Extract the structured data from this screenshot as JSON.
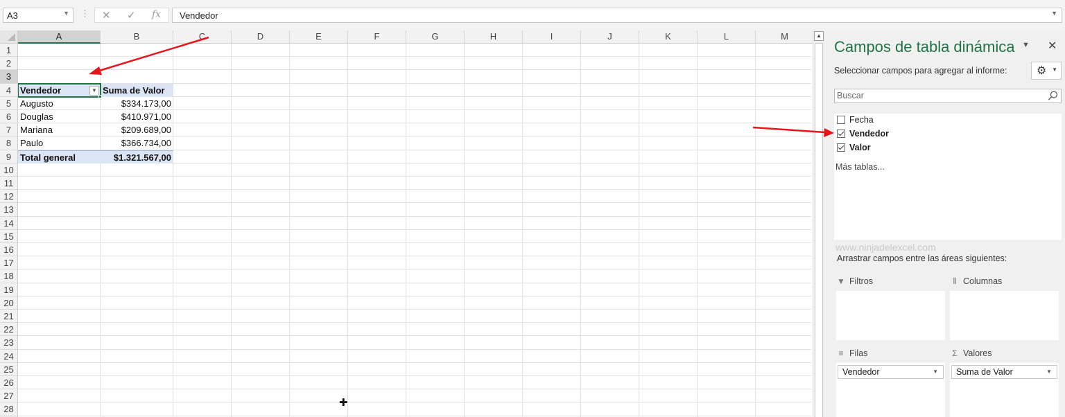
{
  "name_box": {
    "value": "A3"
  },
  "formula_bar": {
    "fx": "fx",
    "value": "Vendedor"
  },
  "columns": [
    "A",
    "B",
    "C",
    "D",
    "E",
    "F",
    "G",
    "H",
    "I",
    "J",
    "K",
    "L",
    "M"
  ],
  "rows": [
    "1",
    "2",
    "3",
    "4",
    "5",
    "6",
    "7",
    "8",
    "9",
    "10",
    "11",
    "12",
    "13",
    "14",
    "15",
    "16",
    "17",
    "18",
    "19",
    "20",
    "21",
    "22",
    "23",
    "24",
    "25",
    "26",
    "27",
    "28"
  ],
  "pivot_table": {
    "header_row": [
      "Vendedor",
      "Suma de Valor"
    ],
    "rows": [
      [
        "Augusto",
        "$334.173,00"
      ],
      [
        "Douglas",
        "$410.971,00"
      ],
      [
        "Mariana",
        "$209.689,00"
      ],
      [
        "Paulo",
        "$366.734,00"
      ]
    ],
    "total_row": [
      "Total general",
      "$1.321.567,00"
    ]
  },
  "pane": {
    "title": "Campos de tabla dinámica",
    "subtitle": "Seleccionar campos para agregar al informe:",
    "search_placeholder": "Buscar",
    "fields": [
      {
        "label": "Fecha",
        "checked": false
      },
      {
        "label": "Vendedor",
        "checked": true
      },
      {
        "label": "Valor",
        "checked": true
      }
    ],
    "more_tables": "Más tablas...",
    "watermark": "www.ninjadelexcel.com",
    "drag_label": "Arrastrar campos entre las áreas siguientes:",
    "areas": {
      "filters": {
        "label": "Filtros"
      },
      "columns": {
        "label": "Columnas"
      },
      "rows": {
        "label": "Filas",
        "item": "Vendedor"
      },
      "values": {
        "label": "Valores",
        "item": "Suma de Valor"
      }
    }
  },
  "colors": {
    "accent": "#217346",
    "arrow": "#e8151b",
    "pivot_header": "#dbe5f3"
  }
}
